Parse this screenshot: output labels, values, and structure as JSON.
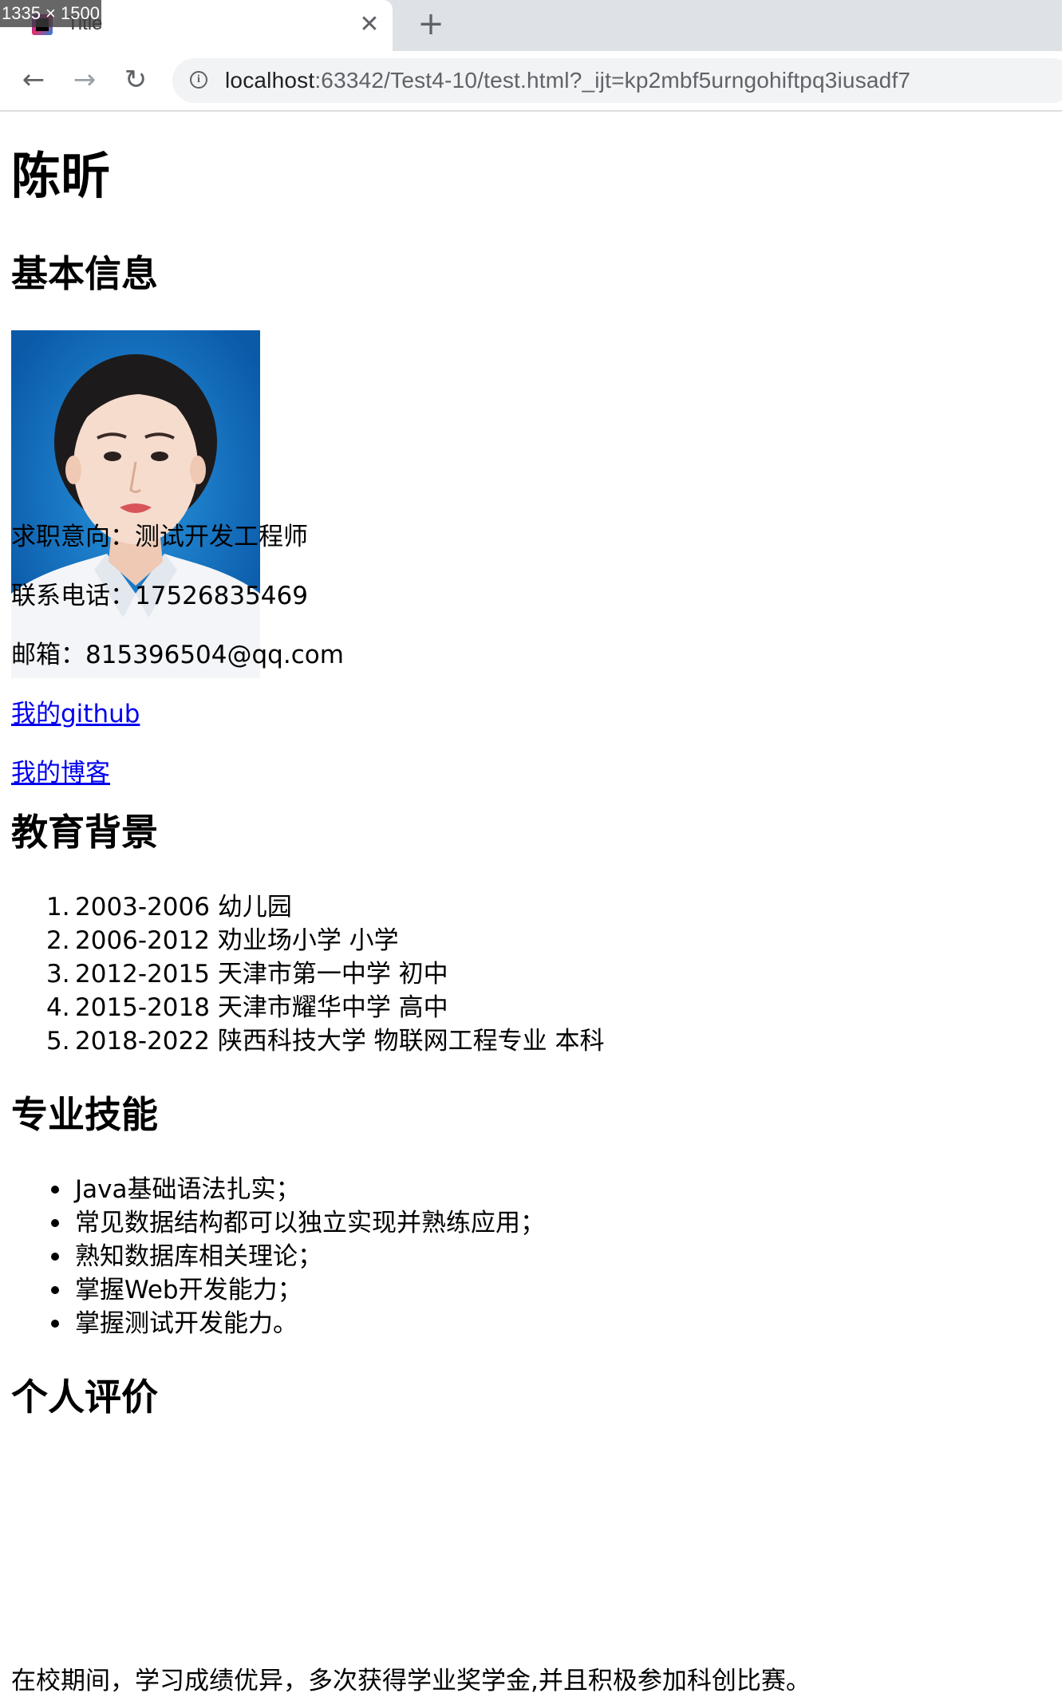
{
  "browser": {
    "size_badge": "1335 × 1500",
    "tab_title": "Title",
    "close_symbol": "✕",
    "new_tab_symbol": "+",
    "back_symbol": "←",
    "forward_symbol": "→",
    "reload_symbol": "↻",
    "info_symbol": "i",
    "url_host": "localhost",
    "url_rest": ":63342/Test4-10/test.html?_ijt=kp2mbf5urngohiftpq3iusadf7"
  },
  "page": {
    "name": "陈昕",
    "section_basic": "基本信息",
    "job_intent": "求职意向：测试开发工程师",
    "phone": "联系电话：17526835469",
    "email": "邮箱：815396504@qq.com",
    "github_link": "我的github",
    "blog_link": "我的博客",
    "section_education": "教育背景",
    "education": [
      {
        "marker": "1.",
        "text": "2003-2006 幼儿园"
      },
      {
        "marker": "2.",
        "text": "2006-2012 劝业场小学 小学"
      },
      {
        "marker": "3.",
        "text": "2012-2015 天津市第一中学 初中"
      },
      {
        "marker": "4.",
        "text": "2015-2018 天津市耀华中学 高中"
      },
      {
        "marker": "5.",
        "text": "2018-2022 陕西科技大学 物联网工程专业 本科"
      }
    ],
    "section_skills": "专业技能",
    "skills": [
      "Java基础语法扎实；",
      "常见数据结构都可以独立实现并熟练应用；",
      "熟知数据库相关理论；",
      "掌握Web开发能力；",
      "掌握测试开发能力。"
    ],
    "section_evaluation": "个人评价",
    "evaluation": "在校期间，学习成绩优异，多次获得学业奖学金,并且积极参加科创比赛。"
  },
  "colors": {
    "link": "#0000ee",
    "tabstrip": "#dee1e6",
    "omnibox": "#f1f3f4",
    "photo_background": "#1c86d6"
  }
}
